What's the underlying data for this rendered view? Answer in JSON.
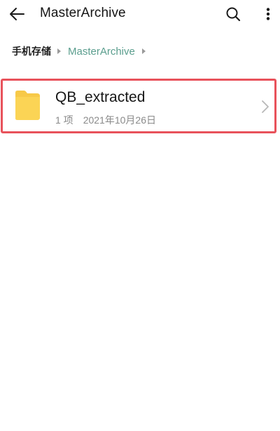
{
  "header": {
    "title": "MasterArchive",
    "icons": {
      "back": "arrow-left-icon",
      "search": "search-icon",
      "more": "more-vertical-icon"
    }
  },
  "breadcrumb": {
    "items": [
      "手机存储",
      "MasterArchive"
    ]
  },
  "files": [
    {
      "name": "QB_extracted",
      "count": "1 项",
      "date": "2021年10月26日",
      "icon": "folder-icon"
    }
  ],
  "colors": {
    "accent": "#5b9e8e",
    "folder": "#f7c948",
    "highlight": "#e8525b"
  }
}
